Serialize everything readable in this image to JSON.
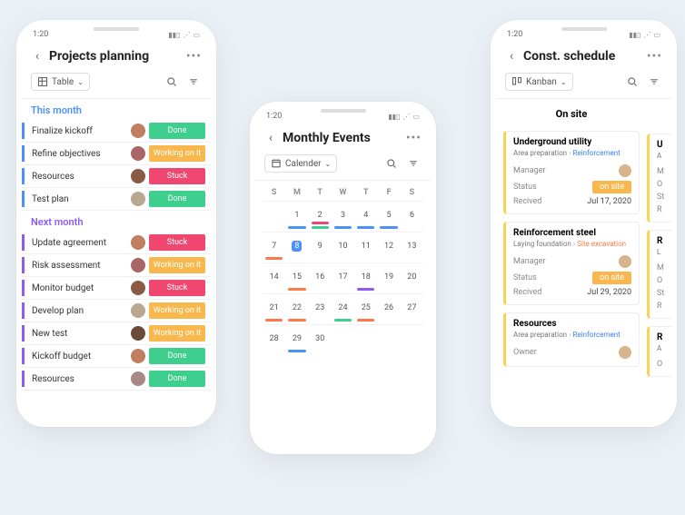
{
  "colors": {
    "done": "#3ecf8e",
    "working": "#f8b84e",
    "stuck": "#ef476f",
    "blue": "#4a90ff",
    "purple": "#8b5cf6",
    "orange": "#ff7849"
  },
  "phone1": {
    "time": "1:20",
    "title": "Projects planning",
    "view_label": "Table",
    "groups": [
      {
        "name": "This month",
        "color": "#4a90ff",
        "rows": [
          {
            "name": "Finalize kickoff",
            "status": "Done",
            "status_color": "#3ecf8e",
            "avatar": "#c08060"
          },
          {
            "name": "Refine objectives",
            "status": "Working on it",
            "status_color": "#f8b84e",
            "avatar": "#a66"
          },
          {
            "name": "Resources",
            "status": "Stuck",
            "status_color": "#ef476f",
            "avatar": "#8a5a44"
          },
          {
            "name": "Test plan",
            "status": "Done",
            "status_color": "#3ecf8e",
            "avatar": "#b8a890"
          }
        ]
      },
      {
        "name": "Next month",
        "color": "#8b5cf6",
        "rows": [
          {
            "name": "Update agreement",
            "status": "Stuck",
            "status_color": "#ef476f",
            "avatar": "#c08060"
          },
          {
            "name": "Risk assessment",
            "status": "Working on it",
            "status_color": "#f8b84e",
            "avatar": "#a66"
          },
          {
            "name": "Monitor budget",
            "status": "Stuck",
            "status_color": "#ef476f",
            "avatar": "#8a5a44"
          },
          {
            "name": "Develop plan",
            "status": "Working on it",
            "status_color": "#f8b84e",
            "avatar": "#b8a890"
          },
          {
            "name": "New test",
            "status": "Working on it",
            "status_color": "#f8b84e",
            "avatar": "#6b4a3a"
          },
          {
            "name": "Kickoff budget",
            "status": "Done",
            "status_color": "#3ecf8e",
            "avatar": "#c08060"
          },
          {
            "name": "Resources",
            "status": "Done",
            "status_color": "#3ecf8e",
            "avatar": "#a88"
          }
        ]
      }
    ]
  },
  "phone2": {
    "time": "1:20",
    "title": "Monthly Events",
    "view_label": "Calender",
    "weekdays": [
      "S",
      "M",
      "T",
      "W",
      "T",
      "F",
      "S"
    ],
    "cells": [
      [
        {
          "n": "",
          "dim": true
        },
        {
          "n": "1",
          "ev": [
            "#4a90ff"
          ]
        },
        {
          "n": "2",
          "ev": [
            "#3ecf8e",
            "#ef476f"
          ]
        },
        {
          "n": "3",
          "ev": [
            "#4a90ff"
          ]
        },
        {
          "n": "4",
          "ev": [
            "#4a90ff"
          ]
        },
        {
          "n": "5",
          "ev": [
            "#4a90ff"
          ]
        },
        {
          "n": "6"
        }
      ],
      [
        {
          "n": "7",
          "ev": [
            "#ff7849"
          ]
        },
        {
          "n": "8",
          "sel": true
        },
        {
          "n": "9"
        },
        {
          "n": "10"
        },
        {
          "n": "11"
        },
        {
          "n": "12"
        },
        {
          "n": "13"
        }
      ],
      [
        {
          "n": "14"
        },
        {
          "n": "15",
          "ev": [
            "#ff7849"
          ]
        },
        {
          "n": "16"
        },
        {
          "n": "17"
        },
        {
          "n": "18",
          "ev": [
            "#8b5cf6"
          ]
        },
        {
          "n": "19"
        },
        {
          "n": "20"
        }
      ],
      [
        {
          "n": "21",
          "ev": [
            "#ff7849"
          ]
        },
        {
          "n": "22",
          "ev": [
            "#ff7849"
          ]
        },
        {
          "n": "23"
        },
        {
          "n": "24",
          "ev": [
            "#3ecf8e"
          ]
        },
        {
          "n": "25",
          "ev": [
            "#ff7849"
          ]
        },
        {
          "n": "26"
        },
        {
          "n": "27"
        }
      ],
      [
        {
          "n": "28"
        },
        {
          "n": "29",
          "ev": [
            "#4a90ff"
          ]
        },
        {
          "n": "30"
        },
        {
          "n": "",
          "dim": true
        },
        {
          "n": "",
          "dim": true
        },
        {
          "n": "",
          "dim": true
        },
        {
          "n": "",
          "dim": true
        }
      ]
    ]
  },
  "phone3": {
    "time": "1:20",
    "title": "Const. schedule",
    "view_label": "Kanban",
    "column_title": "On site",
    "cards": [
      {
        "title": "Underground utility",
        "crumb_a": "Area preparation",
        "crumb_b": "Reinforcement",
        "rows": [
          {
            "label": "Manager",
            "type": "avatar"
          },
          {
            "label": "Status",
            "type": "pill",
            "value": "on site"
          },
          {
            "label": "Recived",
            "type": "text",
            "value": "Jul 17, 2020"
          }
        ]
      },
      {
        "title": "Reinforcement steel",
        "crumb_a": "Laying foundation",
        "crumb_b": "Site excavation",
        "crumb_b_color": "#ff7849",
        "rows": [
          {
            "label": "Manager",
            "type": "avatar"
          },
          {
            "label": "Status",
            "type": "pill",
            "value": "on site"
          },
          {
            "label": "Recived",
            "type": "text",
            "value": "Jul 29, 2020"
          }
        ]
      },
      {
        "title": "Resources",
        "crumb_a": "Area preparation",
        "crumb_b": "Reinforcement",
        "rows": [
          {
            "label": "Owner",
            "type": "avatar"
          }
        ]
      }
    ],
    "peek_cards": [
      {
        "title": "U",
        "sub": "A",
        "rows": [
          "M",
          "O",
          "St",
          "R"
        ]
      },
      {
        "title": "R",
        "sub": "L",
        "rows": [
          "M",
          "O",
          "St",
          "R"
        ]
      },
      {
        "title": "R",
        "sub": "A",
        "rows": [
          "O"
        ]
      }
    ]
  }
}
